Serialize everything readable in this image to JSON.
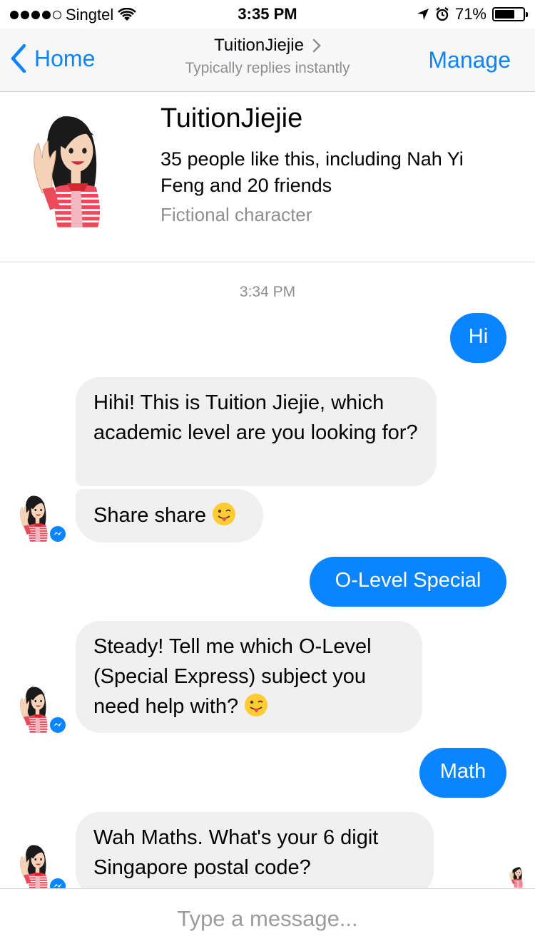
{
  "status_bar": {
    "carrier": "Singtel",
    "time": "3:35 PM",
    "battery_percent": "71%",
    "battery_level": 0.71
  },
  "nav": {
    "back_label": "Home",
    "title": "TuitionJiejie",
    "subtitle": "Typically replies instantly",
    "manage_label": "Manage"
  },
  "profile": {
    "name": "TuitionJiejie",
    "likes": "35 people like this, including Nah Yi Feng and 20 friends",
    "category": "Fictional character"
  },
  "conversation": {
    "timestamp": "3:34 PM",
    "messages": [
      {
        "from": "me",
        "text": "Hi"
      },
      {
        "from": "bot",
        "text": "Hihi! This is Tuition Jiejie, which academic level are you looking for?"
      },
      {
        "from": "bot",
        "text": "Share share",
        "emoji": "tongue-face"
      },
      {
        "from": "me",
        "text": "O-Level Special"
      },
      {
        "from": "bot",
        "text": "Steady! Tell me which O-Level (Special Express) subject you need help with?",
        "emoji": "tongue-face"
      },
      {
        "from": "me",
        "text": "Math"
      },
      {
        "from": "bot",
        "text": "Wah Maths. What's your 6 digit Singapore postal code?"
      }
    ]
  },
  "composer": {
    "placeholder": "Type a message..."
  },
  "colors": {
    "accent": "#0a84ff",
    "incoming_bubble": "#f0f0f0"
  }
}
